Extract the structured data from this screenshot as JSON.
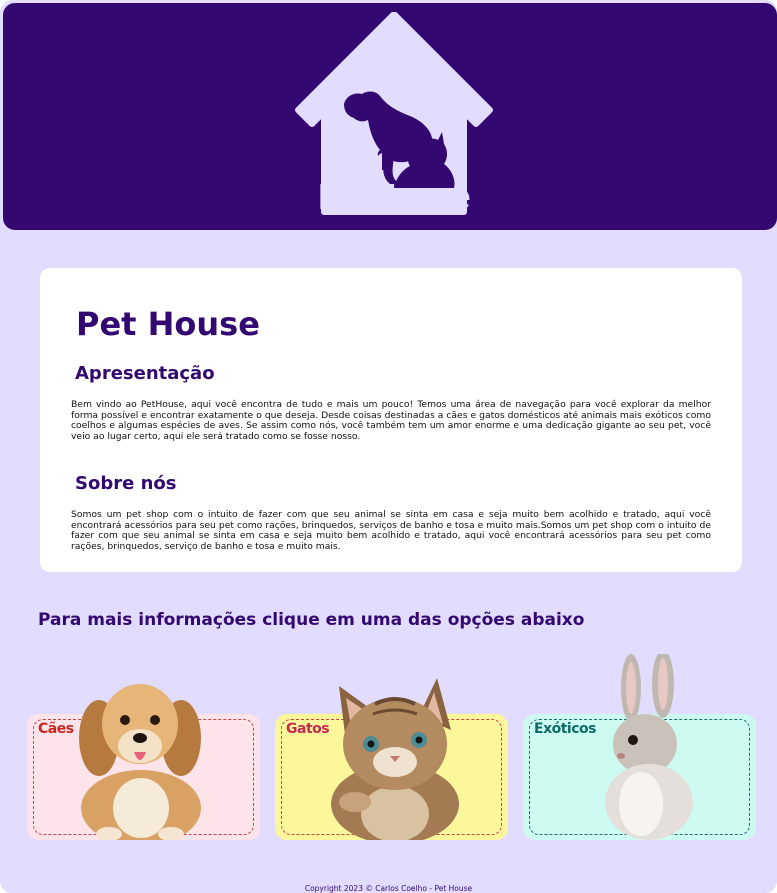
{
  "header": {
    "logo_text_bold": "Pet",
    "logo_text_regular": "House"
  },
  "content": {
    "title": "Pet House",
    "sections": [
      {
        "heading": "Apresentação",
        "text": "Bem vindo ao PetHouse, aqui você encontra de tudo e mais um pouco! Temos uma área de navegação para você explorar da melhor forma possível e encontrar exatamente o que deseja. Desde coisas destinadas a cães e gatos domésticos até animais mais exóticos como coelhos e algumas espécies de aves. Se assim como nós, você também tem um amor enorme e uma dedicação gigante ao seu pet, você veio ao lugar certo, aqui ele será tratado como se fosse nosso."
      },
      {
        "heading": "Sobre nós",
        "text": "Somos um pet shop com o intuito de fazer com que seu animal se sinta em casa e seja muito bem acolhido e tratado, aqui você encontrará acessórios para seu pet como rações, brinquedos, serviços de banho e tosa e muito mais.Somos um pet shop com o intuito de fazer com que seu animal se sinta em casa e seja muito bem acolhido e tratado, aqui você encontrará acessórios para seu pet como rações, brinquedos, serviço de banho e tosa e muito mais."
      }
    ]
  },
  "info_heading": "Para mais informações clique em uma das opções abaixo",
  "categories": [
    {
      "label": "Cães",
      "bg_color": "#fde3ea",
      "label_color": "#c8281e",
      "border_color": "#c0474b",
      "animal": "dog"
    },
    {
      "label": "Gatos",
      "bg_color": "#fbf79a",
      "label_color": "#c42a52",
      "border_color": "#c0474b",
      "animal": "cat"
    },
    {
      "label": "Exóticos",
      "bg_color": "#cdfbf1",
      "label_color": "#0f6a67",
      "border_color": "#1f6e6c",
      "animal": "rabbit"
    }
  ],
  "footer": {
    "copyright": "Copyright 2023 © Carlos Coelho - Pet House"
  },
  "colors": {
    "primary": "#330870",
    "page_bg": "#e2dcff",
    "card_bg": "#ffffff"
  }
}
